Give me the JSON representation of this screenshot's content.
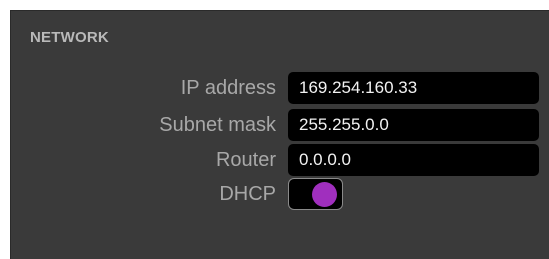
{
  "network": {
    "title": "NETWORK",
    "ip_address": {
      "label": "IP address",
      "value": "169.254.160.33"
    },
    "subnet_mask": {
      "label": "Subnet mask",
      "value": "255.255.0.0"
    },
    "router": {
      "label": "Router",
      "value": "0.0.0.0"
    },
    "dhcp": {
      "label": "DHCP",
      "enabled": true,
      "accent_color": "#a02fbe"
    }
  }
}
